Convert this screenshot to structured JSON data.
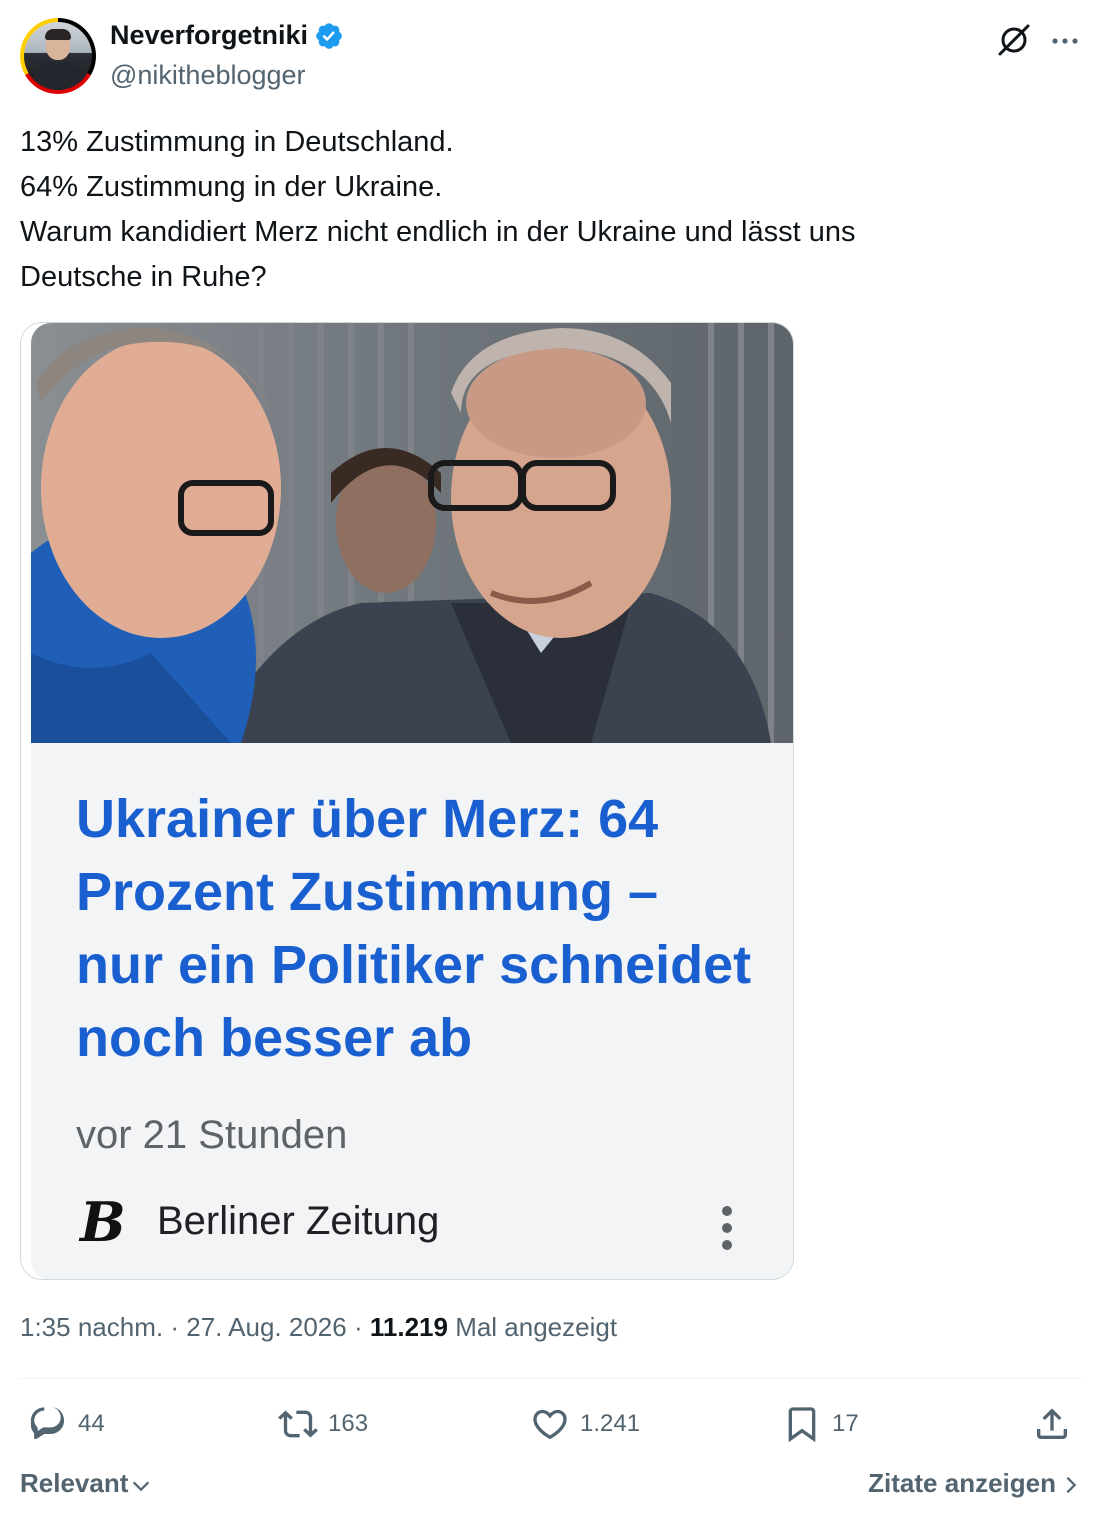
{
  "author": {
    "display_name": "Neverforgetniki",
    "handle": "@nikitheblogger",
    "verified": true,
    "verified_color": "#1d9bf0"
  },
  "header_icons": [
    "grok-icon",
    "more-icon"
  ],
  "tweet": {
    "lines": [
      "13% Zustimmung in Deutschland.",
      "64% Zustimmung in der Ukraine.",
      "Warum kandidiert Merz nicht endlich in der Ukraine und lässt uns",
      "Deutsche in Ruhe?"
    ]
  },
  "card": {
    "headline_lines": [
      "Ukrainer über Merz: 64",
      "Prozent Zustimmung –",
      "nur ein Politiker schneidet",
      "noch besser ab"
    ],
    "headline_color": "#1a5fd0",
    "time_ago": "vor 21 Stunden",
    "source_name": "Berliner Zeitung",
    "source_logo_letter": "B"
  },
  "meta": {
    "time": "1:35 nachm.",
    "separator": "·",
    "date": "27. Aug. 2026",
    "views_count": "11.219",
    "views_label": "Mal angezeigt"
  },
  "actions": {
    "replies": "44",
    "reposts": "163",
    "likes": "1.241",
    "bookmarks": "17"
  },
  "footer": {
    "sort_label": "Relevant",
    "quotes_label": "Zitate anzeigen"
  }
}
